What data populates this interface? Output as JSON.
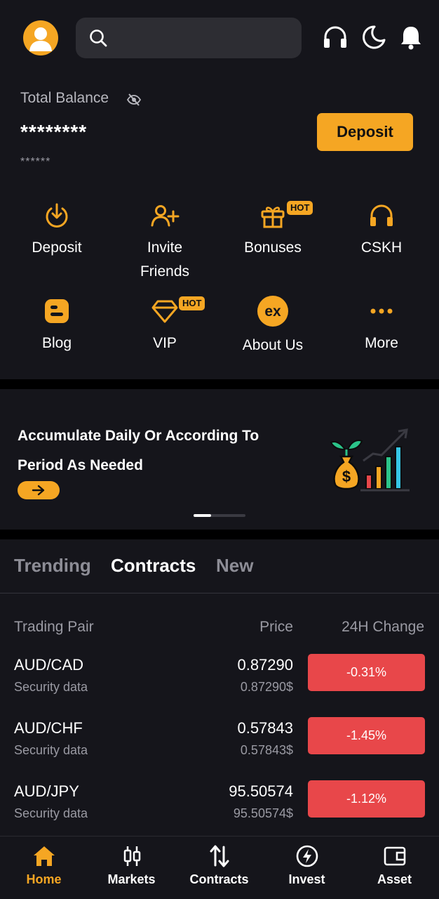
{
  "colors": {
    "accent": "#f5a623",
    "negative": "#e8474a",
    "background": "#15151b"
  },
  "header": {
    "avatar_icon": "user-avatar-icon",
    "search_icon": "search-icon",
    "icons": [
      "headset-icon",
      "moon-icon",
      "bell-icon"
    ]
  },
  "balance": {
    "label": "Total Balance",
    "value": "********",
    "sub_value": "******",
    "deposit_button": "Deposit"
  },
  "quick_actions": [
    {
      "label": "Deposit",
      "icon": "deposit-icon"
    },
    {
      "label": "Invite\nFriends",
      "icon": "invite-friends-icon"
    },
    {
      "label": "Bonuses",
      "icon": "gift-icon",
      "badge": "HOT"
    },
    {
      "label": "CSKH",
      "icon": "headset-icon"
    },
    {
      "label": "Blog",
      "icon": "blog-icon"
    },
    {
      "label": "VIP",
      "icon": "diamond-icon",
      "badge": "HOT"
    },
    {
      "label": "About Us",
      "icon": "ex-logo-icon"
    },
    {
      "label": "More",
      "icon": "more-icon"
    }
  ],
  "banner": {
    "title": "Accumulate Daily Or According To Period As Needed",
    "active_slide": 1
  },
  "market": {
    "tabs": [
      "Trending",
      "Contracts",
      "New"
    ],
    "active_tab": "Contracts",
    "columns": {
      "pair": "Trading Pair",
      "price": "Price",
      "change": "24H Change"
    },
    "rows": [
      {
        "pair": "AUD/CAD",
        "sub": "Security data",
        "price": "0.87290",
        "price_sub": "0.87290$",
        "change": "-0.31%"
      },
      {
        "pair": "AUD/CHF",
        "sub": "Security data",
        "price": "0.57843",
        "price_sub": "0.57843$",
        "change": "-1.45%"
      },
      {
        "pair": "AUD/JPY",
        "sub": "Security data",
        "price": "95.50574",
        "price_sub": "95.50574$",
        "change": "-1.12%"
      }
    ]
  },
  "nav": [
    {
      "label": "Home",
      "icon": "home-icon",
      "active": true
    },
    {
      "label": "Markets",
      "icon": "candlestick-icon"
    },
    {
      "label": "Contracts",
      "icon": "swap-arrows-icon"
    },
    {
      "label": "Invest",
      "icon": "lightning-icon"
    },
    {
      "label": "Asset",
      "icon": "wallet-icon"
    }
  ]
}
